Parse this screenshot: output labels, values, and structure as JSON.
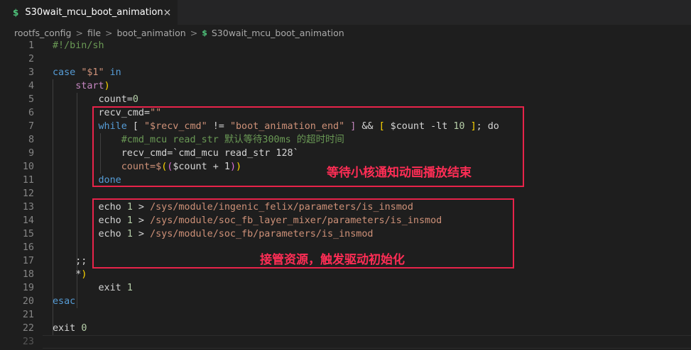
{
  "tab": {
    "icon": "$",
    "title": "S30wait_mcu_boot_animation",
    "close": "×"
  },
  "breadcrumb": {
    "items": [
      "rootfs_config",
      "file",
      "boot_animation"
    ],
    "file_icon": "$",
    "file": "S30wait_mcu_boot_animation",
    "separator": ">"
  },
  "lines": [
    {
      "n": "1",
      "tokens": [
        [
          "cmt",
          "#!/bin/sh"
        ]
      ]
    },
    {
      "n": "2",
      "tokens": []
    },
    {
      "n": "3",
      "tokens": [
        [
          "kw",
          "case"
        ],
        [
          "plain",
          " "
        ],
        [
          "str",
          "\"$1\""
        ],
        [
          "plain",
          " "
        ],
        [
          "kw",
          "in"
        ]
      ]
    },
    {
      "n": "4",
      "tokens": [
        [
          "plain",
          "    "
        ],
        [
          "ctl",
          "start"
        ],
        [
          "gold",
          ")"
        ]
      ]
    },
    {
      "n": "5",
      "tokens": [
        [
          "plain",
          "        count="
        ],
        [
          "num",
          "0"
        ]
      ]
    },
    {
      "n": "6",
      "tokens": [
        [
          "plain",
          "        recv_cmd="
        ],
        [
          "str",
          "\"\""
        ]
      ]
    },
    {
      "n": "7",
      "tokens": [
        [
          "plain",
          "        "
        ],
        [
          "kw",
          "while"
        ],
        [
          "plain",
          " [ "
        ],
        [
          "str",
          "\"$recv_cmd\""
        ],
        [
          "plain",
          " != "
        ],
        [
          "str",
          "\"boot_animation_end\""
        ],
        [
          "plain",
          " "
        ],
        [
          "ctl",
          "]"
        ],
        [
          "plain",
          " && "
        ],
        [
          "gold",
          "["
        ],
        [
          "plain",
          " $count -lt "
        ],
        [
          "num",
          "10"
        ],
        [
          "plain",
          " "
        ],
        [
          "gold",
          "]"
        ],
        [
          "plain",
          "; do"
        ]
      ]
    },
    {
      "n": "8",
      "tokens": [
        [
          "plain",
          "            "
        ],
        [
          "cmt",
          "#cmd_mcu read_str 默认等待300ms 的超时时间"
        ]
      ]
    },
    {
      "n": "9",
      "tokens": [
        [
          "plain",
          "            recv_cmd=`cmd_mcu read_str 128`"
        ]
      ]
    },
    {
      "n": "10",
      "tokens": [
        [
          "plain",
          "            "
        ],
        [
          "str",
          "count=$"
        ],
        [
          "gold",
          "("
        ],
        [
          "pink",
          "("
        ],
        [
          "plain",
          "$count + 1"
        ],
        [
          "pink",
          ")"
        ],
        [
          "gold",
          ")"
        ]
      ]
    },
    {
      "n": "11",
      "tokens": [
        [
          "plain",
          "        "
        ],
        [
          "kw",
          "done"
        ]
      ]
    },
    {
      "n": "12",
      "tokens": []
    },
    {
      "n": "13",
      "tokens": [
        [
          "plain",
          "        echo "
        ],
        [
          "num",
          "1"
        ],
        [
          "plain",
          " > "
        ],
        [
          "str",
          "/sys/module/ingenic_felix/parameters/is_insmod"
        ]
      ]
    },
    {
      "n": "14",
      "tokens": [
        [
          "plain",
          "        echo "
        ],
        [
          "num",
          "1"
        ],
        [
          "plain",
          " > "
        ],
        [
          "str",
          "/sys/module/soc_fb_layer_mixer/parameters/is_insmod"
        ]
      ]
    },
    {
      "n": "15",
      "tokens": [
        [
          "plain",
          "        echo "
        ],
        [
          "num",
          "1"
        ],
        [
          "plain",
          " > "
        ],
        [
          "str",
          "/sys/module/soc_fb/parameters/is_insmod"
        ]
      ]
    },
    {
      "n": "16",
      "tokens": []
    },
    {
      "n": "17",
      "tokens": [
        [
          "plain",
          "    ;;"
        ]
      ]
    },
    {
      "n": "18",
      "tokens": [
        [
          "plain",
          "    *"
        ],
        [
          "gold",
          ")"
        ]
      ]
    },
    {
      "n": "19",
      "tokens": [
        [
          "plain",
          "        exit "
        ],
        [
          "num",
          "1"
        ]
      ]
    },
    {
      "n": "20",
      "tokens": [
        [
          "kw",
          "esac"
        ]
      ]
    },
    {
      "n": "21",
      "tokens": []
    },
    {
      "n": "22",
      "tokens": [
        [
          "plain",
          "exit "
        ],
        [
          "num",
          "0"
        ]
      ]
    },
    {
      "n": "23",
      "tokens": []
    }
  ],
  "annotations": [
    {
      "text": "等待小核通知动画播放结束"
    },
    {
      "text": "接管资源，触发驱动初始化"
    }
  ],
  "colors": {
    "background": "#1e1e1e",
    "annotation": "#ff2d55",
    "box": "#e8234a"
  }
}
